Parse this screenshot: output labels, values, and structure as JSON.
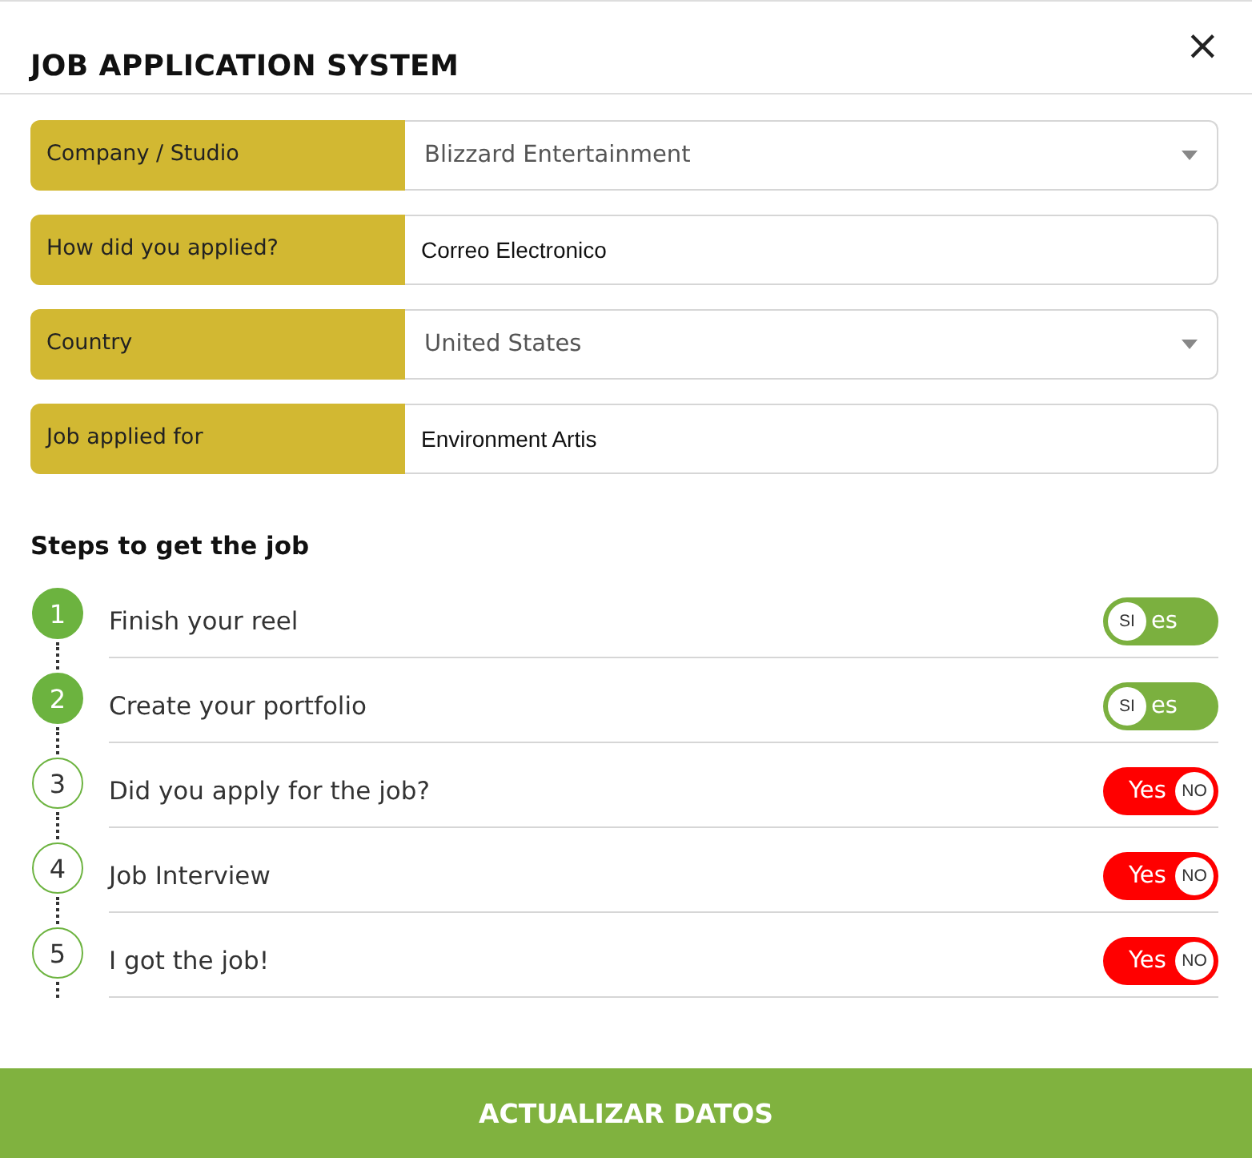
{
  "window": {
    "title": "JOB APPLICATION SYSTEM",
    "close": "×"
  },
  "fields": [
    {
      "kind": "select",
      "label": "Company / Studio",
      "value": "Blizzard Entertainment"
    },
    {
      "kind": "input",
      "label": "How did you applied?",
      "value": "Correo Electronico"
    },
    {
      "kind": "select",
      "label": "Country",
      "value": "United States"
    },
    {
      "kind": "input",
      "label": "Job applied for",
      "value": "Environment Artis"
    }
  ],
  "steps_title": "Steps to get the job",
  "steps": [
    {
      "number": "1",
      "label": "Finish your reel",
      "on": true,
      "knob_label": "SI",
      "track_label": "es"
    },
    {
      "number": "2",
      "label": "Create your portfolio",
      "on": true,
      "knob_label": "SI",
      "track_label": "es"
    },
    {
      "number": "3",
      "label": "Did you apply for the job?",
      "on": false,
      "knob_label": "NO",
      "track_label": "Yes"
    },
    {
      "number": "4",
      "label": "Job Interview",
      "on": false,
      "knob_label": "NO",
      "track_label": "Yes"
    },
    {
      "number": "5",
      "label": "I got the job!",
      "on": false,
      "knob_label": "NO",
      "track_label": "Yes"
    }
  ],
  "submit": "ACTUALIZAR DATOS"
}
